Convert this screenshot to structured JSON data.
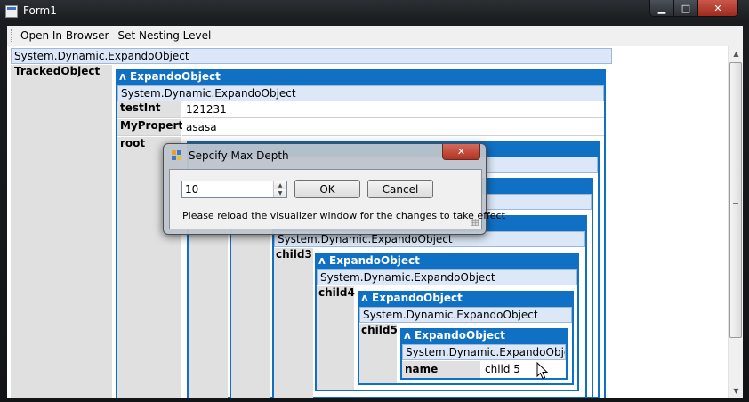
{
  "window": {
    "title": "Form1",
    "minimize": "▁",
    "maximize": "□",
    "close": "✕"
  },
  "menu": {
    "items": [
      "Open In Browser",
      "Set Nesting Level"
    ]
  },
  "root_type": "System.Dynamic.ExpandoObject",
  "tracked_label": "TrackedObject",
  "level1": {
    "header": "ExpandoObject",
    "type": "System.Dynamic.ExpandoObject",
    "rows": [
      {
        "key": "testInt",
        "value": "121231"
      },
      {
        "key": "MyProperty",
        "value": "asasa"
      }
    ],
    "root_label": "root"
  },
  "level3": {
    "type": "System.Dynamic.ExpandoObject",
    "child_label": "child3"
  },
  "level4": {
    "header": "ExpandoObject",
    "type": "System.Dynamic.ExpandoObject",
    "child_label": "child4"
  },
  "level5": {
    "header": "ExpandoObject",
    "type": "System.Dynamic.ExpandoObject",
    "child_label": "child5"
  },
  "level6": {
    "header": "ExpandoObject",
    "type": "System.Dynamic.ExpandoObject",
    "rows": [
      {
        "key": "name",
        "value": "child 5"
      }
    ]
  },
  "collapse_glyph": "ʌ",
  "dialog": {
    "title": "Sepcify Max Depth",
    "close": "✕",
    "depth_value": "10",
    "ok_label": "OK",
    "cancel_label": "Cancel",
    "message": "Please reload the visualizer window for the changes to take effect"
  },
  "icons": [
    "app-icon",
    "dialog-icon",
    "close-icon",
    "spin-up-icon",
    "spin-down-icon",
    "scroll-up-icon",
    "scroll-down-icon",
    "mouse-cursor-icon"
  ]
}
